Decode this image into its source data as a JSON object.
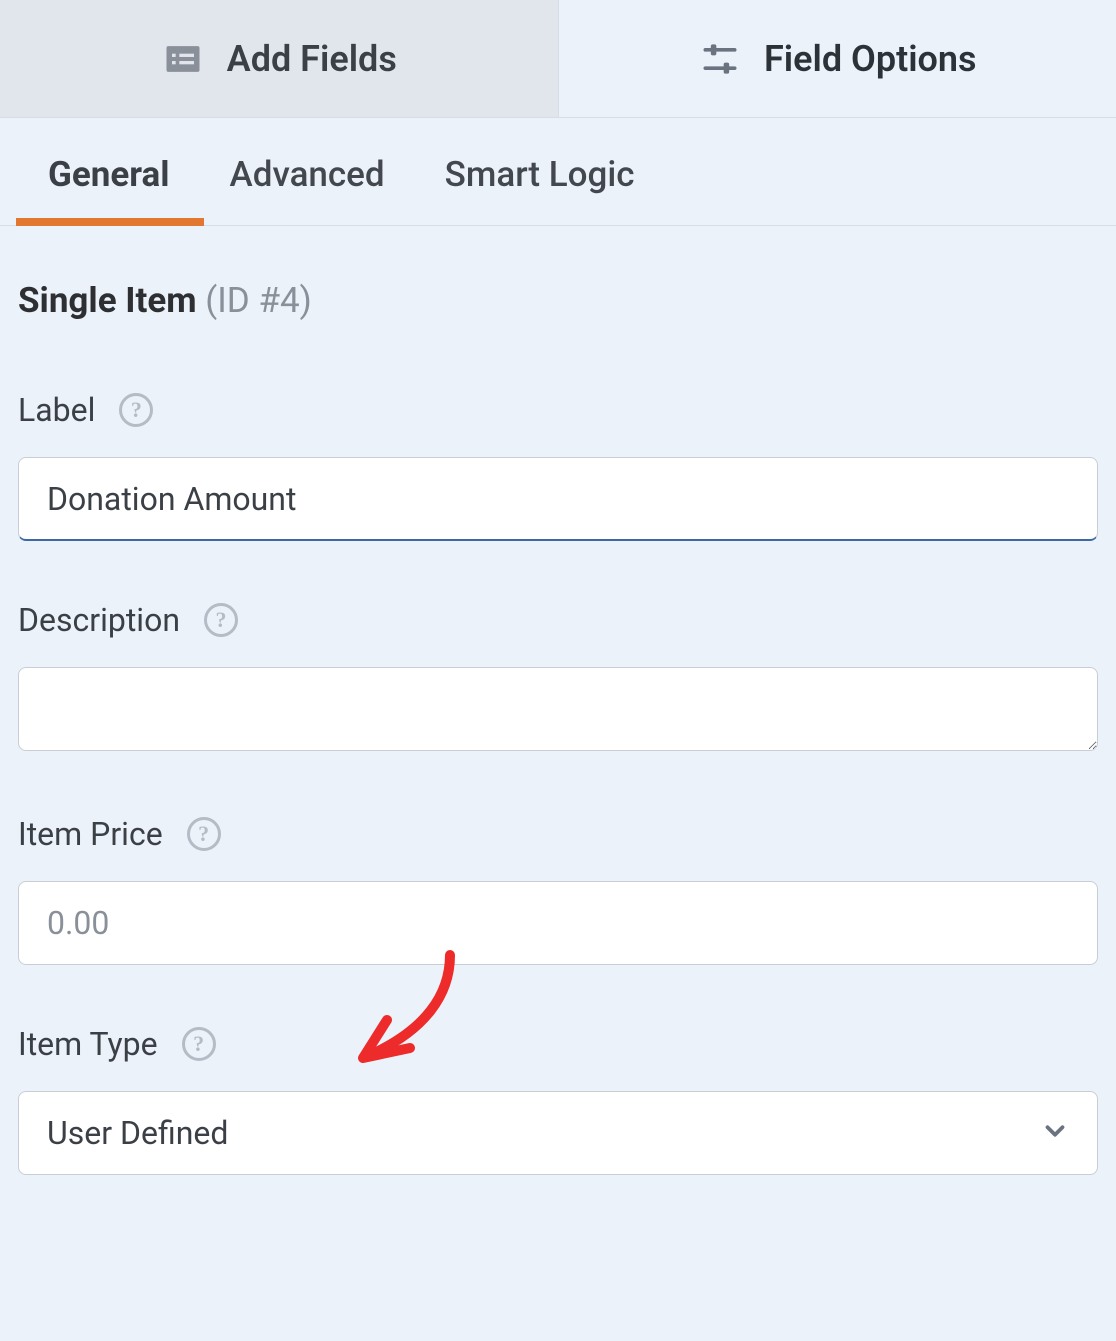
{
  "topTabs": {
    "addFields": "Add Fields",
    "fieldOptions": "Field Options"
  },
  "subTabs": {
    "general": "General",
    "advanced": "Advanced",
    "smartLogic": "Smart Logic"
  },
  "section": {
    "title": "Single Item",
    "id": "(ID #4)"
  },
  "fields": {
    "label": {
      "title": "Label",
      "value": "Donation Amount"
    },
    "description": {
      "title": "Description",
      "value": ""
    },
    "itemPrice": {
      "title": "Item Price",
      "placeholder": "0.00",
      "value": ""
    },
    "itemType": {
      "title": "Item Type",
      "value": "User Defined"
    }
  }
}
